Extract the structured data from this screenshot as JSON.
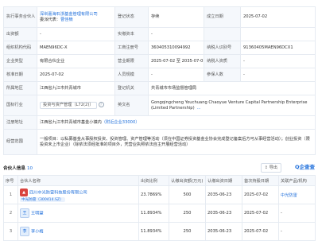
{
  "info": {
    "executive_partner_label": "执行事务合伙人",
    "executive_partner_value": "深圳嘉海石浙基金管理有限公司",
    "executive_partner_note": "委派代表：",
    "executive_partner_rep": "曹佳楠",
    "reg_status_label": "登记状态",
    "reg_status_value": "存续",
    "est_date_label": "成立日期",
    "est_date_value": "2025-07-02",
    "capital_label": "出资额",
    "capital_value": "-",
    "actual_capital_label": "实缴资本",
    "actual_capital_value": "-",
    "org_code_label": "组织机构代码",
    "org_code_value": "MAEN96DC-X",
    "biz_reg_label": "工商注册号",
    "biz_reg_value": "360405310094992",
    "taxpayer_id_label": "纳税人识别号",
    "taxpayer_id_value": "91360405MAEN96DCX1",
    "company_type_label": "企业类型",
    "company_type_value": "有限合伙企业",
    "biz_term_label": "营业期限",
    "biz_term_value": "2025-07-02 至 2035-07-01",
    "taxpayer_qual_label": "纳税人资质",
    "taxpayer_qual_value": "-",
    "approval_date_label": "核准日期",
    "approval_date_value": "2025-07-02",
    "staff_label": "人员规模",
    "staff_value": "-",
    "insured_label": "参保人数",
    "insured_value": "-",
    "region_label": "所属地区",
    "region_value": "江西省九江市共青城市",
    "authority_label": "登记机关",
    "authority_value": "共青城市市场监督管理局",
    "industry_label": "国标行业",
    "industry_value": "投资与资产管理（L72(2)）",
    "english_name_label": "英文名",
    "english_name_value": "Gongqingcheng Youchuang Chaoyue Venture Capital Partnership Enterprise (Limited Partnership)",
    "ops": "...",
    "address_label": "注册地址",
    "address_value": "江西省九江市共青城市基金小镇内",
    "address_extra": "（附近企业33000）",
    "scope_label": "经营范围",
    "scope_value": "一般项目：以私募基金从事股权投资、投资管理、资产管理等活动（须在中国证券投资基金业协会完成登记备案后方可从事经营活动）；创业投资（限投资未上市企业）（除依法须经批准的项目外，凭营业执照依法自主开展经营活动）"
  },
  "shareholders": {
    "title": "合伙人信息",
    "count": "10",
    "export_label": "导出",
    "brand": "企查查",
    "columns": [
      "序号",
      "合伙人名称",
      "出资比例",
      "认缴出资额(万元)",
      "认缴出资日期",
      "首次持股日期",
      "关联产品/机构"
    ],
    "rows": [
      {
        "rank": "1",
        "name": "四川中光防雷科技股份有限公司",
        "tag": "中光防雷（300414.SZ）",
        "ratio": "23.7869%",
        "amount": "500",
        "sub_date": "2035-06-23",
        "first_date": "2025-07-02",
        "related": "中光防雷"
      },
      {
        "rank": "2",
        "name": "王明望",
        "tag": "",
        "ratio": "11.8934%",
        "amount": "250",
        "sub_date": "2035-06-23",
        "first_date": "2025-07-02",
        "related": "-"
      },
      {
        "rank": "3",
        "name": "李小梅",
        "tag": "",
        "ratio": "11.8934%",
        "amount": "250",
        "sub_date": "2035-06-23",
        "first_date": "2025-07-02",
        "related": "-"
      }
    ]
  }
}
